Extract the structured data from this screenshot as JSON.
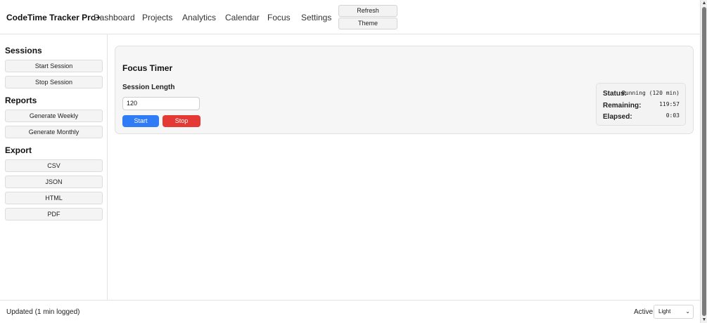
{
  "header": {
    "brand": "CodeTime Tracker Pro+",
    "nav": [
      "Dashboard",
      "Projects",
      "Analytics",
      "Calendar",
      "Focus",
      "Settings"
    ],
    "refresh_label": "Refresh",
    "theme_label": "Theme"
  },
  "sidebar": {
    "sessions_heading": "Sessions",
    "start_session": "Start Session",
    "stop_session": "Stop Session",
    "reports_heading": "Reports",
    "generate_weekly": "Generate Weekly",
    "generate_monthly": "Generate Monthly",
    "export_heading": "Export",
    "export_csv": "CSV",
    "export_json": "JSON",
    "export_html": "HTML",
    "export_pdf": "PDF"
  },
  "main": {
    "title": "Focus Timer",
    "length_label": "Session Length",
    "length_value": "120",
    "start_label": "Start",
    "stop_label": "Stop",
    "status": {
      "status_label": "Status:",
      "status_value": "Running (120 min)",
      "remaining_label": "Remaining:",
      "remaining_value": "119:57",
      "elapsed_label": "Elapsed:",
      "elapsed_value": "0:03"
    }
  },
  "footer": {
    "status_text": "Updated (1 min logged)",
    "active_label": "Active",
    "theme_value": "Light"
  },
  "colors": {
    "start_button": "#2f7cf6",
    "stop_button": "#e53935"
  }
}
